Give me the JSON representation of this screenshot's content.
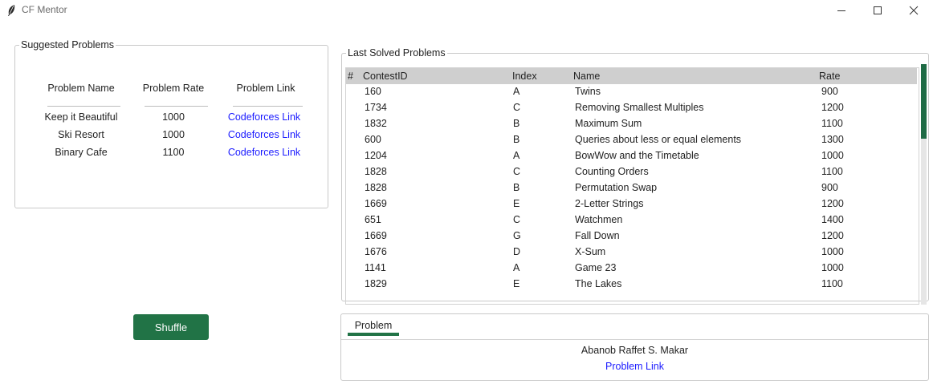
{
  "window": {
    "title": "CF Mentor"
  },
  "suggested": {
    "legend": "Suggested Problems",
    "headers": [
      "Problem Name",
      "Problem Rate",
      "Problem Link"
    ],
    "rows": [
      {
        "name": "Keep it Beautiful",
        "rate": "1000",
        "link": "Codeforces Link"
      },
      {
        "name": "Ski Resort",
        "rate": "1000",
        "link": "Codeforces Link"
      },
      {
        "name": "Binary Cafe",
        "rate": "1100",
        "link": "Codeforces Link"
      }
    ]
  },
  "last_solved": {
    "legend": "Last Solved Problems",
    "headers": [
      "#",
      "ContestID",
      "Index",
      "Name",
      "Rate"
    ],
    "rows": [
      [
        "160",
        "A",
        "Twins",
        "900"
      ],
      [
        "1734",
        "C",
        "Removing Smallest Multiples",
        "1200"
      ],
      [
        "1832",
        "B",
        "Maximum Sum",
        "1100"
      ],
      [
        "600",
        "B",
        "Queries about less or equal elements",
        "1300"
      ],
      [
        "1204",
        "A",
        "BowWow and the Timetable",
        "1000"
      ],
      [
        "1828",
        "C",
        "Counting Orders",
        "1100"
      ],
      [
        "1828",
        "B",
        "Permutation Swap",
        "900"
      ],
      [
        "1669",
        "E",
        "2-Letter Strings",
        "1200"
      ],
      [
        "651",
        "C",
        "Watchmen",
        "1400"
      ],
      [
        "1669",
        "G",
        "Fall Down",
        "1200"
      ],
      [
        "1676",
        "D",
        "X-Sum",
        "1000"
      ],
      [
        "1141",
        "A",
        "Game 23",
        "1000"
      ],
      [
        "1829",
        "E",
        "The Lakes",
        "1100"
      ]
    ]
  },
  "shuffle_label": "Shuffle",
  "problem_panel": {
    "tab_label": "Problem",
    "author": "Abanob Raffet S. Makar",
    "link": "Problem Link"
  },
  "colors": {
    "accent": "#217346",
    "link": "#1a1aff",
    "header_bg": "#cfcfcf"
  }
}
